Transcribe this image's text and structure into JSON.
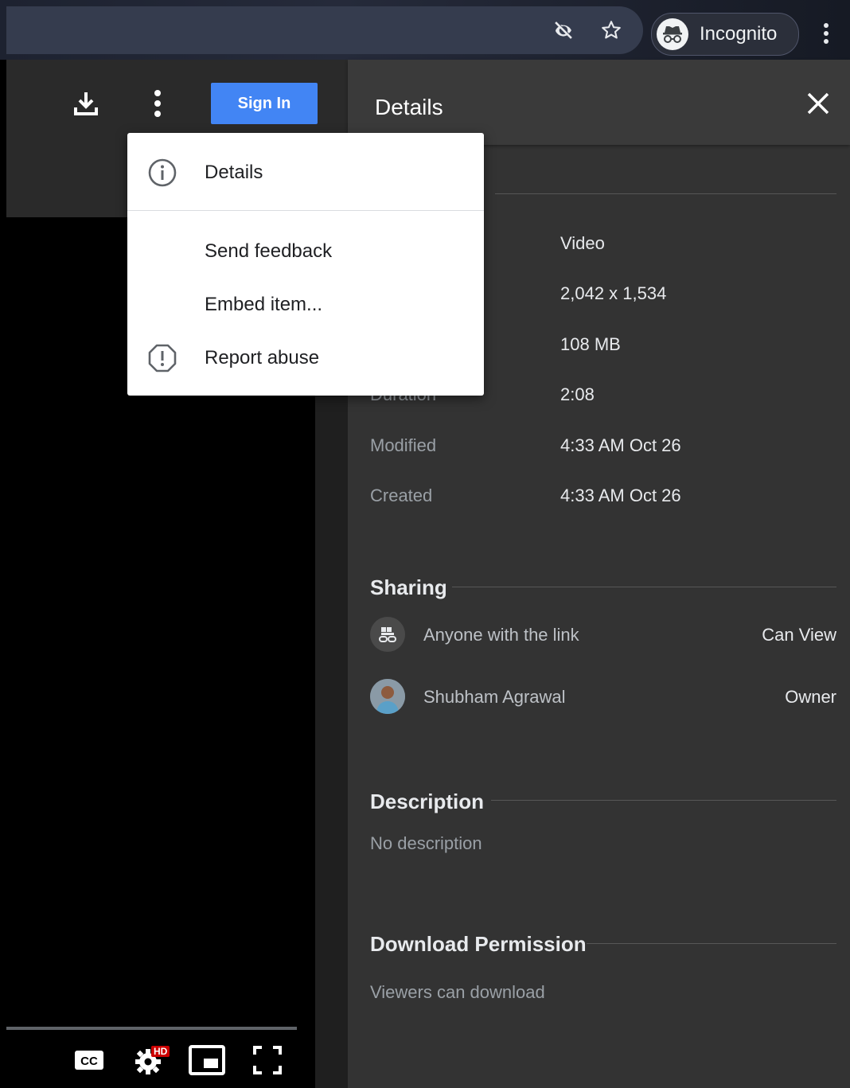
{
  "browser": {
    "profile_label": "Incognito",
    "icons": [
      "eye-off-icon",
      "star-icon",
      "incognito-icon",
      "more-vertical-icon"
    ]
  },
  "viewer": {
    "signin_label": "Sign In",
    "icons": [
      "download-icon",
      "more-vertical-icon"
    ],
    "controls": [
      "closed-captions-icon",
      "settings-icon",
      "miniplayer-icon",
      "fullscreen-icon"
    ],
    "hd_badge": "HD"
  },
  "menu": {
    "items": [
      {
        "label": "Details",
        "icon": "info-icon"
      },
      {
        "label": "Send feedback",
        "icon": ""
      },
      {
        "label": "Embed item...",
        "icon": ""
      },
      {
        "label": "Report abuse",
        "icon": "report-icon"
      }
    ]
  },
  "details": {
    "title": "Details",
    "rows": [
      {
        "label": "",
        "value": "Video"
      },
      {
        "label": "",
        "value": "2,042 x 1,534"
      },
      {
        "label": "",
        "value": "108 MB"
      },
      {
        "label": "Duration",
        "value": "2:08"
      },
      {
        "label": "Modified",
        "value": "4:33 AM Oct 26"
      },
      {
        "label": "Created",
        "value": "4:33 AM Oct 26"
      }
    ],
    "sharing": {
      "title": "Sharing",
      "entries": [
        {
          "name": "Anyone with the link",
          "role": "Can View"
        },
        {
          "name": "Shubham Agrawal",
          "role": "Owner"
        }
      ]
    },
    "description": {
      "title": "Description",
      "text": "No description"
    },
    "download_permission": {
      "title": "Download Permission",
      "text": "Viewers can download"
    }
  },
  "colors": {
    "accent": "#4285f4",
    "panel_bg": "#333333",
    "menu_bg": "#ffffff",
    "badge_red": "#cc0000"
  }
}
